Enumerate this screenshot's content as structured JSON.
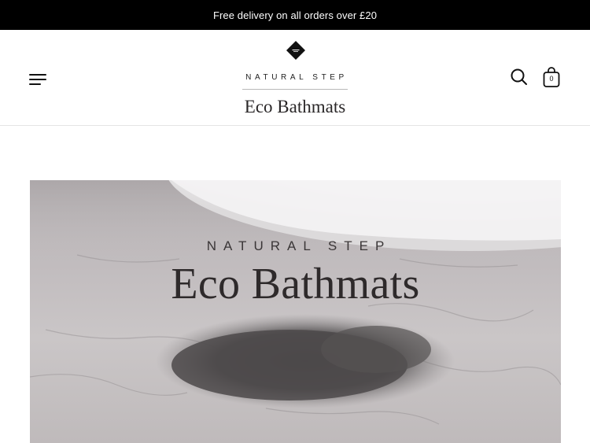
{
  "announcement": {
    "text": "Free delivery on all orders over £20"
  },
  "header": {
    "logo": {
      "brand": "NATURAL STEP",
      "product": "Eco Bathmats"
    },
    "cart": {
      "count": "0"
    },
    "icons": {
      "menu": "hamburger-menu-icon",
      "search": "search-icon",
      "cart": "shopping-bag-icon"
    }
  },
  "hero": {
    "brand": "NATURAL STEP",
    "title": "Eco Bathmats"
  },
  "colors": {
    "announcement_bg": "#000000",
    "announcement_text": "#ffffff",
    "page_bg": "#ffffff",
    "text": "#111111"
  }
}
